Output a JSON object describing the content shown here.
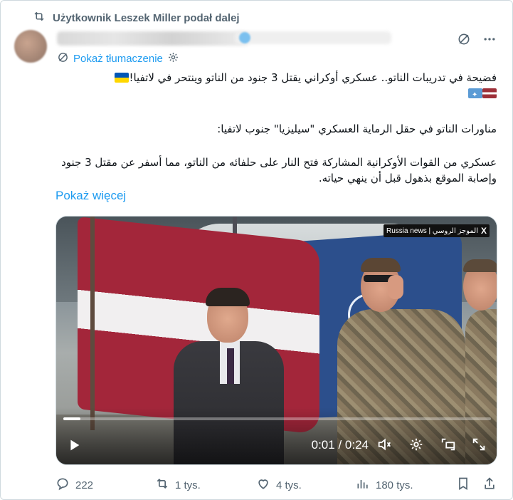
{
  "repost": {
    "label": "Użytkownik Leszek Miller podał dalej"
  },
  "post": {
    "translate_label": "Pokaż tłumaczenie",
    "text_line1": "فضيحة في تدريبات الناتو.. عسكري أوكراني يقتل 3 جنود من الناتو وينتحر في لاتفيا!",
    "text_line2": "مناورات الناتو في حقل الرماية العسكري \"سيليزيا\" جنوب لاتفيا:",
    "text_line3": "عسكري من القوات الأوكرانية المشاركة فتح النار على حلفائه من الناتو، مما أسفر عن مقتل 3 جنود وإصابة الموقع بذهول قبل أن ينهي حياته.",
    "show_more": "Pokaż więcej"
  },
  "video": {
    "watermark_text": "Russia news | الموجز الروسي",
    "current_time": "0:01",
    "separator": "/",
    "duration": "0:24",
    "progress_fraction": 0.04
  },
  "actions": {
    "replies": "222",
    "reposts": "1 tys.",
    "likes": "4 tys.",
    "views": "180 tys."
  },
  "colors": {
    "accent": "#1d9bf0",
    "muted": "#536471",
    "text": "#0f1419"
  },
  "icons": [
    "repost-icon",
    "grok-icon",
    "more-icon",
    "translate-icon",
    "settings-icon",
    "play-icon",
    "volume-icon",
    "settings-icon",
    "pip-icon",
    "fullscreen-icon",
    "reply-icon",
    "like-icon",
    "views-icon",
    "bookmark-icon",
    "share-icon"
  ]
}
